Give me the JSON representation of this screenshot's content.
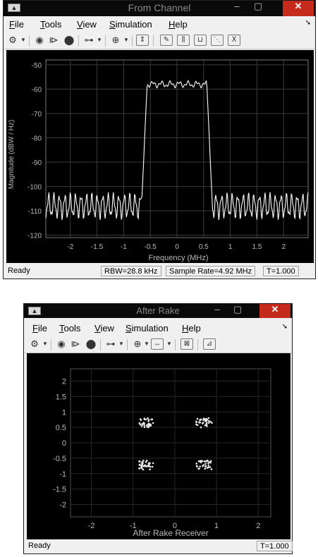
{
  "windows": [
    {
      "title": "From Channel",
      "menu": [
        "File",
        "Tools",
        "View",
        "Simulation",
        "Help"
      ],
      "status": {
        "ready": "Ready",
        "rbw": "RBW=28.8 kHz",
        "sample_rate": "Sample Rate=4.92 MHz",
        "time": "T=1.000"
      },
      "axes": {
        "ylabel": "Magnitude (dBW / Hz)",
        "xlabel": "Frequency (MHz)",
        "yticks": [
          "-50",
          "-60",
          "-70",
          "-80",
          "-90",
          "-100",
          "-110",
          "-120"
        ],
        "xticks": [
          "-2",
          "-1.5",
          "-1",
          "-0.5",
          "0",
          "0.5",
          "1",
          "1.5",
          "2"
        ]
      }
    },
    {
      "title": "After Rake",
      "menu": [
        "File",
        "Tools",
        "View",
        "Simulation",
        "Help"
      ],
      "status": {
        "ready": "Ready",
        "time": "T=1.000"
      },
      "axes": {
        "xlabel": "After Rake Receiver",
        "yticks": [
          "2",
          "1.5",
          "1",
          "0.5",
          "0",
          "-0.5",
          "-1",
          "-1.5",
          "-2"
        ],
        "xticks": [
          "-2",
          "-1",
          "0",
          "1",
          "2"
        ]
      }
    }
  ],
  "chart_data": [
    {
      "type": "line",
      "series": [
        {
          "values_note": "",
          "color": "#ffffff"
        }
      ],
      "x_range": [
        -2.46,
        2.46
      ],
      "ylim": [
        -121,
        -48
      ],
      "grid": true,
      "passband_level": -58,
      "passband_edges": [
        -0.6,
        0.6
      ],
      "stopband_level": -108
    },
    {
      "type": "scatter",
      "xlim": [
        -2.5,
        2.3
      ],
      "ylim": [
        -2.4,
        2.4
      ],
      "grid": true,
      "cluster_centers": [
        [
          -0.7,
          0.65
        ],
        [
          0.7,
          0.65
        ],
        [
          -0.7,
          -0.72
        ],
        [
          0.7,
          -0.72
        ]
      ]
    }
  ]
}
